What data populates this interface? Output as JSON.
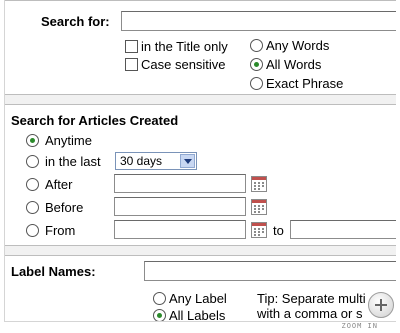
{
  "search": {
    "label": "Search for:",
    "value": "",
    "options": {
      "title_only": "in the Title only",
      "case_sensitive": "Case sensitive",
      "any_words": "Any Words",
      "all_words": "All Words",
      "exact_phrase": "Exact Phrase"
    }
  },
  "created": {
    "heading": "Search for Articles Created",
    "anytime": "Anytime",
    "in_the_last": "in the last",
    "period_value": "30 days",
    "after": "After",
    "before": "Before",
    "from": "From",
    "to": "to"
  },
  "labels": {
    "heading": "Label Names:",
    "any_label": "Any Label",
    "all_labels": "All Labels",
    "tip_line1": "Tip: Separate multi",
    "tip_line2": "with a comma or s"
  },
  "zoom": {
    "label": "ZOOM IN"
  },
  "colors": {
    "panel_border": "#bdbdbd",
    "gutter": "#f1f1f1",
    "radio_selected": "#2b8a2b"
  }
}
